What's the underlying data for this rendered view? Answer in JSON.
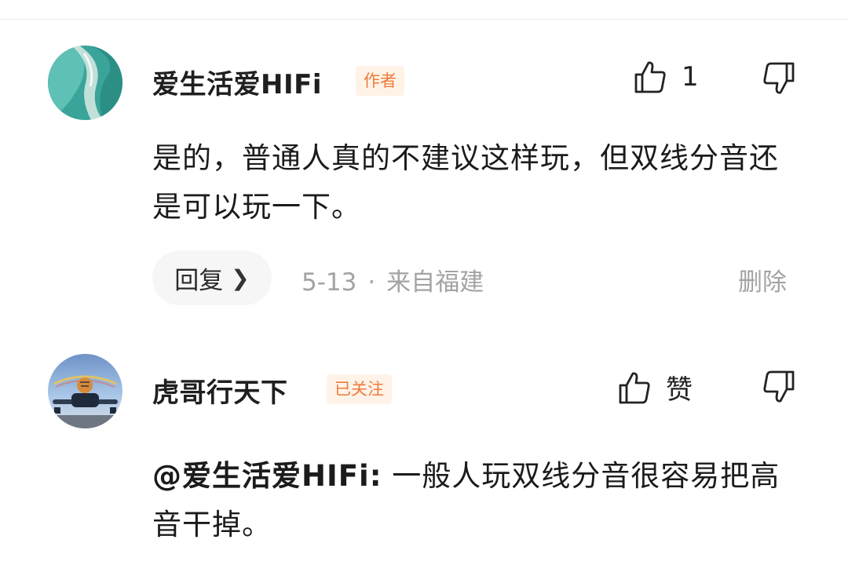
{
  "comments": [
    {
      "author": "爱生活爱HIFi",
      "badge": "作者",
      "like_label": "1",
      "text": "是的，普通人真的不建议这样玩，但双线分音还是可以玩一下。",
      "reply_label": "回复",
      "date": "5-13",
      "separator": "·",
      "location": "来自福建",
      "delete_label": "删除",
      "avatar_icon": "ocean-beach-avatar"
    },
    {
      "author": "虎哥行天下",
      "badge": "已关注",
      "like_label": "赞",
      "mention": "@爱生活爱HIFi:",
      "text": " 一般人玩双线分音很容易把高音干掉。",
      "avatar_icon": "tiger-airplane-avatar"
    }
  ],
  "colors": {
    "badge_text": "#ee7b3a",
    "badge_bg": "#fff3e8",
    "meta_text": "#a3a3a3"
  }
}
